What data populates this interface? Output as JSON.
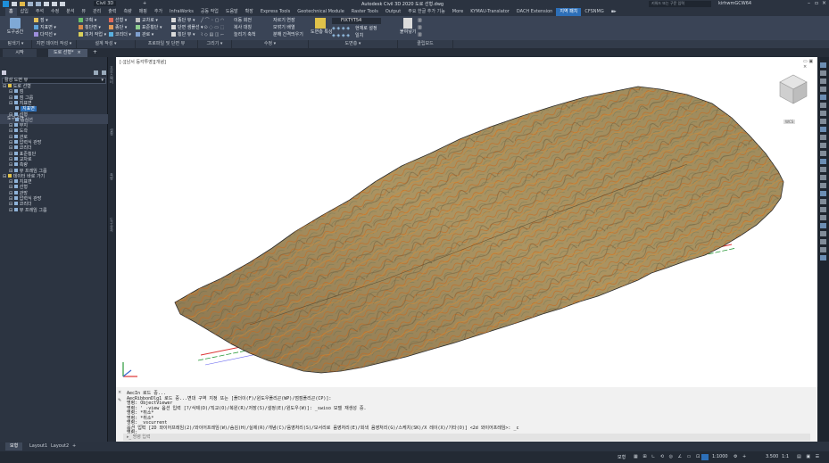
{
  "window": {
    "app_search": "Civil 3D",
    "title": "Autodesk Civil 3D 2020   도로 선형.dwg",
    "search_placeholder": "키워드 또는 구문 입력",
    "user": "kirhwmGCW64",
    "quick_tabs_count": "+"
  },
  "ribbon_tabs": [
    "홈",
    "삽입",
    "주석",
    "수정",
    "분석",
    "뷰",
    "관리",
    "출력",
    "측량",
    "매핑",
    "추가",
    "InfraWorks",
    "공동 작업",
    "도움말",
    "확장",
    "Express Tools",
    "Geotechnical Module",
    "Raster Tools",
    "Output",
    "주요 한글 추가 기능",
    "More",
    "KYMAU-Translator",
    "DACH Extension",
    "지역 패치",
    "CFSNMG"
  ],
  "active_tab_index": 0,
  "highlight_tab_index": 23,
  "ribbon": {
    "col1": [
      "도구공간"
    ],
    "col2": [
      "점 ▾",
      "지표면 ▾",
      "다각선 ▾"
    ],
    "col3": [
      "구획 ▾",
      "횡단면 ▾",
      "피처 작업 ▾"
    ],
    "col4": [
      "선형 ▾",
      "종단 ▾",
      "코리더 ▾"
    ],
    "col5": [
      "교차로 ▾",
      "표준횡단 ▾",
      "관로 ▾"
    ],
    "col6": [
      "종단 뷰 ▾",
      "단면 샘플선 ▾",
      "횡단 뷰 ▾"
    ],
    "col7": [
      "이동",
      "회전",
      "복사",
      "대칭",
      "늘리기",
      "축척"
    ],
    "col8": [
      "자르기",
      "연장",
      "모깎기",
      "배열",
      "분해",
      "간격띄우기"
    ],
    "col9": [
      "도면층 특성"
    ],
    "col10": [
      "현재로 설정",
      "일치",
      "도면층 상태"
    ],
    "col11": [
      "붙여넣기",
      "클립보드"
    ],
    "layer_value": "FIXTYT54"
  },
  "panels": [
    "탐색기 ▾",
    "지면 데이터 작성 ▾",
    "설계 작성 ▾",
    "프로파일 및 단면 뷰",
    "그리기 ▾",
    "수정 ▾",
    "도면층 ▾",
    "클립보드"
  ],
  "doc_tabs": [
    "시작",
    "도로 선형*"
  ],
  "toolspace": {
    "title": "도구공간",
    "dropdown": "활성 도면 뷰",
    "tree": [
      {
        "label": "도로 선형",
        "indent": 0
      },
      {
        "label": "점",
        "indent": 1
      },
      {
        "label": "점 그룹",
        "indent": 1
      },
      {
        "label": "지표면",
        "indent": 1
      },
      {
        "label": "지표면",
        "indent": 2,
        "selected": true
      },
      {
        "label": "선형",
        "indent": 1
      },
      {
        "label": "중심선",
        "indent": 2
      },
      {
        "label": "부지",
        "indent": 1
      },
      {
        "label": "도곽",
        "indent": 1
      },
      {
        "label": "관로",
        "indent": 1
      },
      {
        "label": "압력식 관망",
        "indent": 1
      },
      {
        "label": "코리더",
        "indent": 1
      },
      {
        "label": "표준횡단",
        "indent": 1
      },
      {
        "label": "교차로",
        "indent": 1
      },
      {
        "label": "측량",
        "indent": 1
      },
      {
        "label": "뷰 프레임 그룹",
        "indent": 1
      },
      {
        "label": "데이터 바로 가기",
        "indent": 0
      },
      {
        "label": "지표면",
        "indent": 1
      },
      {
        "label": "선형",
        "indent": 1
      },
      {
        "label": "관망",
        "indent": 1
      },
      {
        "label": "압력식 관망",
        "indent": 1
      },
      {
        "label": "코리더",
        "indent": 1
      },
      {
        "label": "뷰 프레임 그룹",
        "indent": 1
      }
    ]
  },
  "side_tabs": [
    "프로스펙터",
    "설정",
    "측량",
    "도구상자"
  ],
  "viewport": {
    "label": "[-][남서 등각투영][개념]",
    "wcs": "WCS",
    "nav_cube": "남서"
  },
  "command_history": [
    "AecIn 로드 중...",
    "AecRibbonDlg1 로드 중...변대 구역 지정 또는 [폴더이(F)/윈도우폴리곤(WP)/점점폴리곤(CP)]:",
    "명령: ObjectViewer",
    "명령: '_-view 옵션 입력 [?/삭제(D)/직교(O)/복원(R)/저장(S)/설정(E)/윈도우(W)]: _swiso 모델 재생성 중.",
    "명령: *취소*",
    "명령: *취소*",
    "명령: _vscurrent",
    "옵션 입력 [2D 와이어프레임(2)/와이어프레임(W)/숨김(H)/실제(R)/개념(C)/음영처리(S)/모서리로 음영처리(E)/회색 음영처리(G)/스케치(SK)/X 레이(X)/기타(O)] <2d 와이어프레임>: _c",
    "명령:"
  ],
  "command_placeholder": "명령 입력",
  "layout_tabs": [
    "모형",
    "Layout1",
    "Layout2",
    "+"
  ],
  "status": {
    "left": "모형",
    "scale": "1:1000",
    "value": "3.500",
    "zoom": "1:1"
  },
  "colors": {
    "accent": "#2d6fb8",
    "terrain_base": "#a58c5b",
    "contour": "#c86a1f"
  }
}
